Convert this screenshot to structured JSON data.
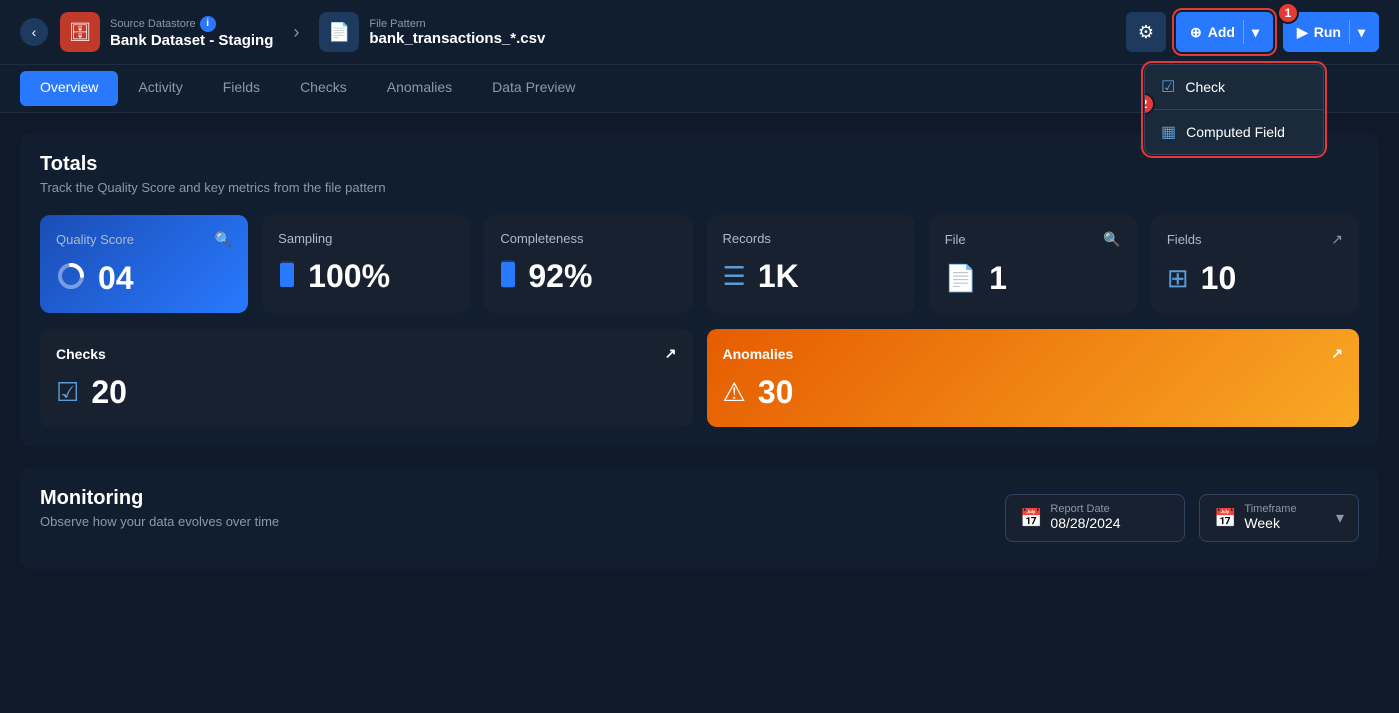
{
  "header": {
    "back_btn": "‹",
    "source": {
      "label": "Source Datastore",
      "info_badge": "i",
      "name": "Bank Dataset - Staging"
    },
    "file_pattern": {
      "label": "File Pattern",
      "name": "bank_transactions_*.csv"
    },
    "settings_icon": "⚙",
    "add_btn": {
      "label": "Add",
      "icon": "⊕",
      "chevron": "▾"
    },
    "run_btn": {
      "label": "Run",
      "icon": "▶",
      "chevron": "▾"
    },
    "badge1": "1",
    "badge2": "2"
  },
  "dropdown": {
    "items": [
      {
        "label": "Check",
        "icon": "☑"
      },
      {
        "label": "Computed Field",
        "icon": "▦"
      }
    ]
  },
  "nav": {
    "tabs": [
      {
        "label": "Overview",
        "active": true
      },
      {
        "label": "Activity",
        "active": false
      },
      {
        "label": "Fields",
        "active": false
      },
      {
        "label": "Checks",
        "active": false
      },
      {
        "label": "Anomalies",
        "active": false
      },
      {
        "label": "Data Preview",
        "active": false
      }
    ]
  },
  "totals": {
    "title": "Totals",
    "subtitle": "Track the Quality Score and key metrics from the file pattern",
    "metrics": [
      {
        "id": "quality-score",
        "label": "Quality Score",
        "value": "04",
        "icon": "ring",
        "has_search": true,
        "active": true
      },
      {
        "id": "sampling",
        "label": "Sampling",
        "value": "100%",
        "icon": "bar",
        "has_search": false,
        "active": false
      },
      {
        "id": "completeness",
        "label": "Completeness",
        "value": "92%",
        "icon": "completeness",
        "has_search": false,
        "active": false
      },
      {
        "id": "records",
        "label": "Records",
        "value": "1K",
        "icon": "records",
        "has_search": false,
        "active": false
      },
      {
        "id": "file",
        "label": "File",
        "value": "1",
        "icon": "file",
        "has_search": true,
        "active": false
      },
      {
        "id": "fields",
        "label": "Fields",
        "value": "10",
        "icon": "fields",
        "has_search": false,
        "has_arrow": true,
        "active": false
      }
    ],
    "checks": {
      "label": "Checks",
      "value": "20",
      "arrow": "↗"
    },
    "anomalies": {
      "label": "Anomalies",
      "value": "30",
      "arrow": "↗"
    }
  },
  "monitoring": {
    "title": "Monitoring",
    "subtitle": "Observe how your data evolves over time",
    "report_date_label": "Report Date",
    "report_date_value": "08/28/2024",
    "timeframe_label": "Timeframe",
    "timeframe_value": "Week"
  }
}
